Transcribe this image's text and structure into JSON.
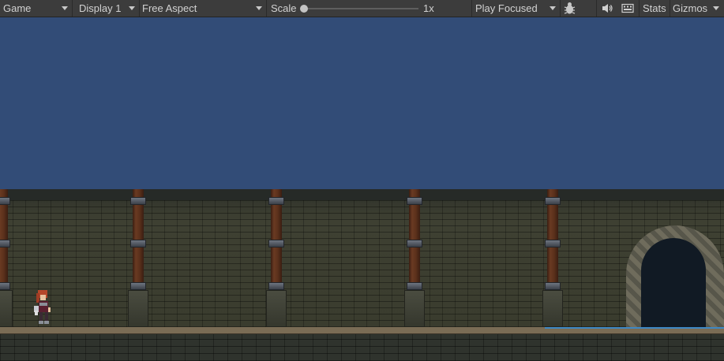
{
  "toolbar": {
    "view_tab": "Game",
    "display": "Display 1",
    "aspect": "Free Aspect",
    "scale_label": "Scale",
    "scale_value": "1x",
    "scale_level": 0.0,
    "play_mode": "Play Focused",
    "bug_icon": "bug-icon",
    "audio_icon": "speaker-icon",
    "keyboard_icon": "keyboard-icon",
    "stats_label": "Stats",
    "gizmos_label": "Gizmos"
  },
  "colors": {
    "toolbar_bg": "#3c3c3c",
    "sky": "#324c77",
    "wall": "#3a3c2e",
    "water": "#3e88c4"
  }
}
